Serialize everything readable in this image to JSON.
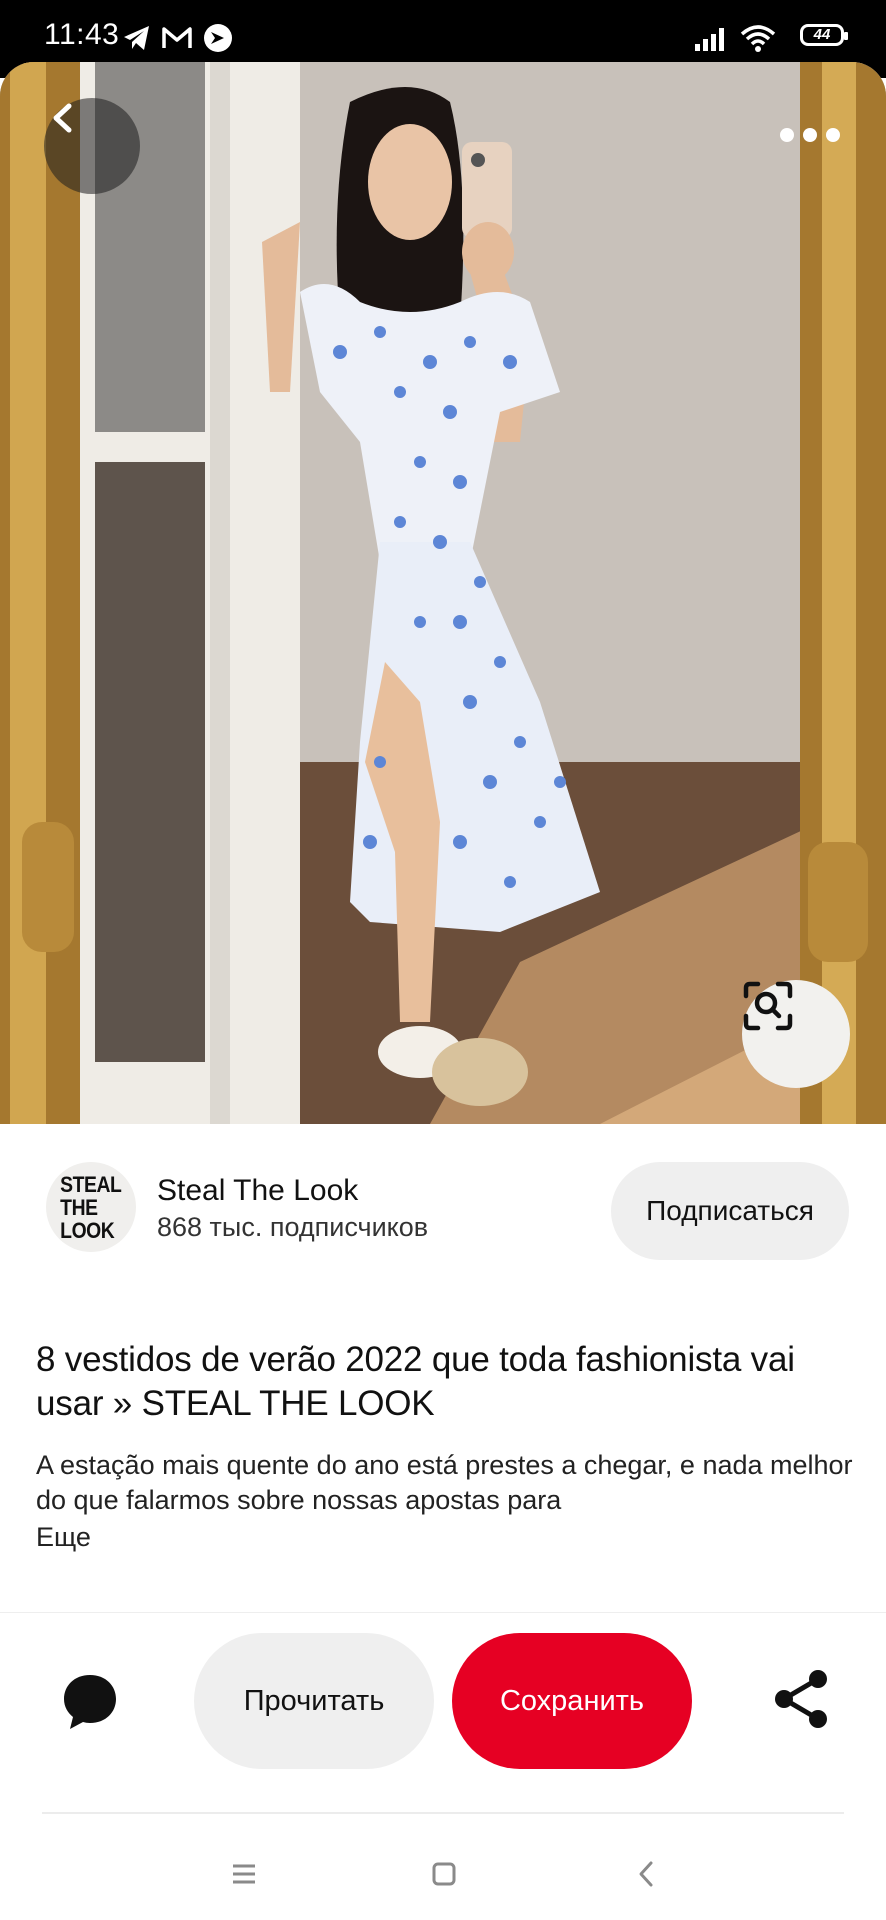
{
  "status_bar": {
    "time": "11:43",
    "battery": "44",
    "icons": [
      "telegram-icon",
      "gmail-icon",
      "vpn-icon",
      "signal-icon",
      "wifi-icon",
      "battery-icon"
    ]
  },
  "image": {
    "alt_icons": [
      "back-arrow-icon",
      "more-dots-icon",
      "visual-search-icon"
    ]
  },
  "creator": {
    "avatar_text": [
      "STEAL",
      "THE",
      "LOOK"
    ],
    "name": "Steal The Look",
    "followers": "868 тыс. подписчиков",
    "follow_label": "Подписаться"
  },
  "pin": {
    "title": "8 vestidos de verão 2022 que toda fashionista vai usar » STEAL THE LOOK",
    "description": "A estação mais quente do ano está prestes a chegar, e nada melhor do que falarmos sobre nossas apostas para",
    "more_label": "Еще"
  },
  "actions": {
    "read_label": "Прочитать",
    "save_label": "Сохранить"
  },
  "colors": {
    "accent": "#e60023",
    "button_gray": "#efefef"
  }
}
